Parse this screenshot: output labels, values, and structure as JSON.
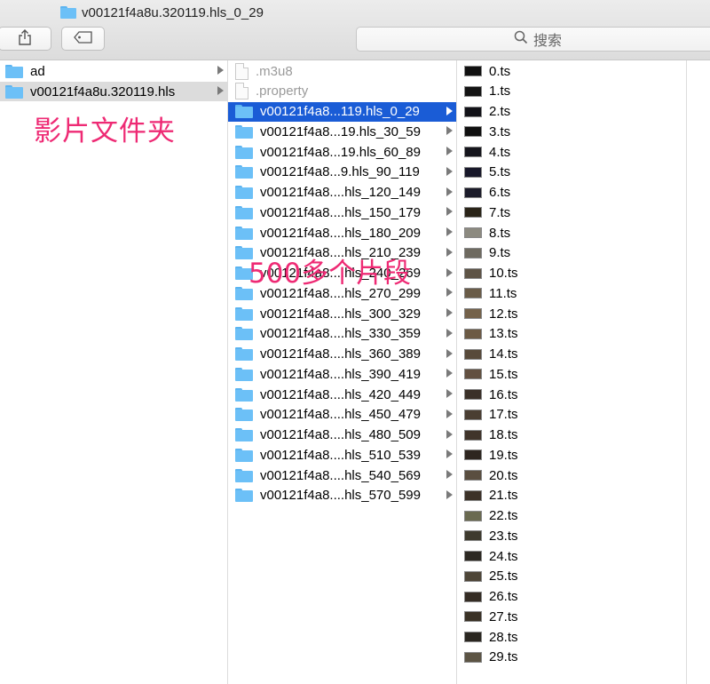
{
  "window": {
    "title": "v00121f4a8u.320119.hls_0_29"
  },
  "toolbar": {
    "share_icon": "share-icon",
    "tag_icon": "tag-icon",
    "search_placeholder": "搜索",
    "search_icon": "search-icon"
  },
  "column1": {
    "items": [
      {
        "label": "ad",
        "type": "folder",
        "has_children": true,
        "selected": false
      },
      {
        "label": "v00121f4a8u.320119.hls",
        "type": "folder",
        "has_children": true,
        "selected": true
      }
    ]
  },
  "column2": {
    "items": [
      {
        "label": ".m3u8",
        "type": "file",
        "muted": true
      },
      {
        "label": ".property",
        "type": "file",
        "muted": true
      },
      {
        "label": "v00121f4a8...119.hls_0_29",
        "type": "folder",
        "has_children": true,
        "selected": true
      },
      {
        "label": "v00121f4a8...19.hls_30_59",
        "type": "folder",
        "has_children": true
      },
      {
        "label": "v00121f4a8...19.hls_60_89",
        "type": "folder",
        "has_children": true
      },
      {
        "label": "v00121f4a8...9.hls_90_119",
        "type": "folder",
        "has_children": true
      },
      {
        "label": "v00121f4a8....hls_120_149",
        "type": "folder",
        "has_children": true
      },
      {
        "label": "v00121f4a8....hls_150_179",
        "type": "folder",
        "has_children": true
      },
      {
        "label": "v00121f4a8....hls_180_209",
        "type": "folder",
        "has_children": true
      },
      {
        "label": "v00121f4a8....hls_210_239",
        "type": "folder",
        "has_children": true
      },
      {
        "label": "v00121f4a8....hls_240_269",
        "type": "folder",
        "has_children": true
      },
      {
        "label": "v00121f4a8....hls_270_299",
        "type": "folder",
        "has_children": true
      },
      {
        "label": "v00121f4a8....hls_300_329",
        "type": "folder",
        "has_children": true
      },
      {
        "label": "v00121f4a8....hls_330_359",
        "type": "folder",
        "has_children": true
      },
      {
        "label": "v00121f4a8....hls_360_389",
        "type": "folder",
        "has_children": true
      },
      {
        "label": "v00121f4a8....hls_390_419",
        "type": "folder",
        "has_children": true
      },
      {
        "label": "v00121f4a8....hls_420_449",
        "type": "folder",
        "has_children": true
      },
      {
        "label": "v00121f4a8....hls_450_479",
        "type": "folder",
        "has_children": true
      },
      {
        "label": "v00121f4a8....hls_480_509",
        "type": "folder",
        "has_children": true
      },
      {
        "label": "v00121f4a8....hls_510_539",
        "type": "folder",
        "has_children": true
      },
      {
        "label": "v00121f4a8....hls_540_569",
        "type": "folder",
        "has_children": true
      },
      {
        "label": "v00121f4a8....hls_570_599",
        "type": "folder",
        "has_children": true
      }
    ]
  },
  "column3": {
    "items": [
      {
        "label": "0.ts",
        "thumb": "#111111"
      },
      {
        "label": "1.ts",
        "thumb": "#141414"
      },
      {
        "label": "2.ts",
        "thumb": "#121218"
      },
      {
        "label": "3.ts",
        "thumb": "#101010"
      },
      {
        "label": "4.ts",
        "thumb": "#15151c"
      },
      {
        "label": "5.ts",
        "thumb": "#18182a"
      },
      {
        "label": "6.ts",
        "thumb": "#1c1c2a"
      },
      {
        "label": "7.ts",
        "thumb": "#2a2418"
      },
      {
        "label": "8.ts",
        "thumb": "#8c8a80"
      },
      {
        "label": "9.ts",
        "thumb": "#6e6a60"
      },
      {
        "label": "10.ts",
        "thumb": "#5e5446"
      },
      {
        "label": "11.ts",
        "thumb": "#6a5c48"
      },
      {
        "label": "12.ts",
        "thumb": "#74624a"
      },
      {
        "label": "13.ts",
        "thumb": "#6c5a44"
      },
      {
        "label": "14.ts",
        "thumb": "#584a3a"
      },
      {
        "label": "15.ts",
        "thumb": "#625040"
      },
      {
        "label": "16.ts",
        "thumb": "#3a3028"
      },
      {
        "label": "17.ts",
        "thumb": "#4a3e32"
      },
      {
        "label": "18.ts",
        "thumb": "#40342a"
      },
      {
        "label": "19.ts",
        "thumb": "#2e2620"
      },
      {
        "label": "20.ts",
        "thumb": "#5a4e40"
      },
      {
        "label": "21.ts",
        "thumb": "#3c3228"
      },
      {
        "label": "22.ts",
        "thumb": "#6a6a50"
      },
      {
        "label": "23.ts",
        "thumb": "#3e3a2e"
      },
      {
        "label": "24.ts",
        "thumb": "#2c2822"
      },
      {
        "label": "25.ts",
        "thumb": "#4e4638"
      },
      {
        "label": "26.ts",
        "thumb": "#342c24"
      },
      {
        "label": "27.ts",
        "thumb": "#3a3226"
      },
      {
        "label": "28.ts",
        "thumb": "#2a2620"
      },
      {
        "label": "29.ts",
        "thumb": "#5c5444"
      }
    ]
  },
  "annotations": {
    "movie_folder": "影片文件夹",
    "segments": "500多个片段"
  },
  "colors": {
    "selection_blue": "#1a5cd6",
    "annotation_pink": "#ee2a74",
    "folder_blue": "#6cc0f7"
  }
}
